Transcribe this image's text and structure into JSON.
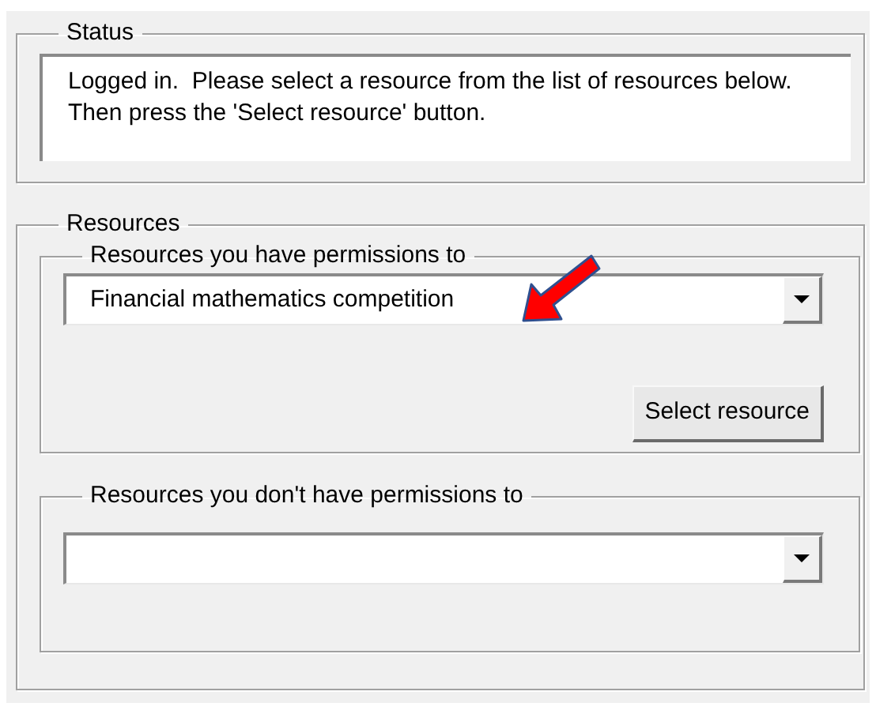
{
  "status": {
    "legend": "Status",
    "message": "Logged in.  Please select a resource from the list of resources below. Then press the 'Select resource' button."
  },
  "resources": {
    "legend": "Resources",
    "permitted": {
      "legend": "Resources you have permissions to",
      "value": "Financial mathematics competition",
      "button": "Select resource"
    },
    "not_permitted": {
      "legend": "Resources you don't have permissions to"
    }
  }
}
